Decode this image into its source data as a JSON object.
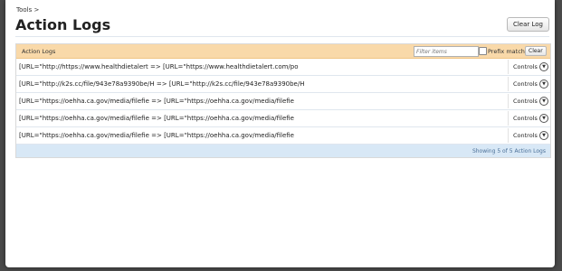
{
  "breadcrumb": "Tools >",
  "page_title": "Action Logs",
  "clear_log_button": "Clear Log",
  "logs": {
    "header_title": "Action Logs",
    "filter_placeholder": "Filter items",
    "prefix_match_label": "Prefix match",
    "filter_clear_button": "Clear",
    "rows": [
      {
        "text": "[URL=\"http://https://www.healthdietalert => [URL=\"https://www.healthdietalert.com/po",
        "controls": "Controls"
      },
      {
        "text": "[URL=\"http://k2s.cc/file/943e78a9390be/H => [URL=\"http://k2s.cc/file/943e78a9390be/H",
        "controls": "Controls"
      },
      {
        "text": "[URL=\"https://oehha.ca.gov/media/filefie => [URL=\"https://oehha.ca.gov/media/filefie",
        "controls": "Controls"
      },
      {
        "text": "[URL=\"https://oehha.ca.gov/media/filefie => [URL=\"https://oehha.ca.gov/media/filefie",
        "controls": "Controls"
      },
      {
        "text": "[URL=\"https://oehha.ca.gov/media/filefie => [URL=\"https://oehha.ca.gov/media/filefie",
        "controls": "Controls"
      }
    ],
    "footer_text": "Showing 5 of 5 Action Logs"
  },
  "icons": {
    "controls": "chevron-down-circle-icon"
  }
}
